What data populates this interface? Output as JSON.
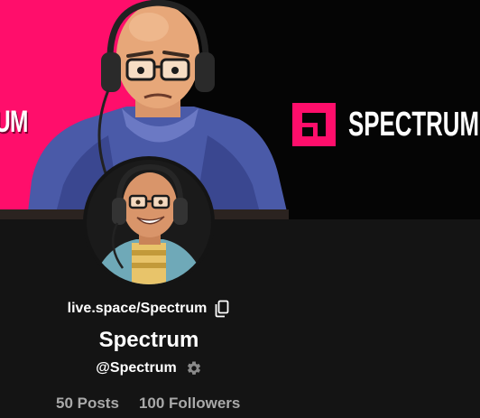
{
  "banner": {
    "left_text": "UM",
    "brand_name": "SPECTRUM",
    "brand_color": "#ff0e6b"
  },
  "avatar": {
    "icon": "avatar-illustration"
  },
  "profile": {
    "link": "live.space/Spectrum",
    "display_name": "Spectrum",
    "handle": "@Spectrum"
  },
  "stats": {
    "posts": "50 Posts",
    "followers": "100 Followers"
  },
  "icons": {
    "copy": "copy-icon",
    "settings": "gear-icon"
  }
}
